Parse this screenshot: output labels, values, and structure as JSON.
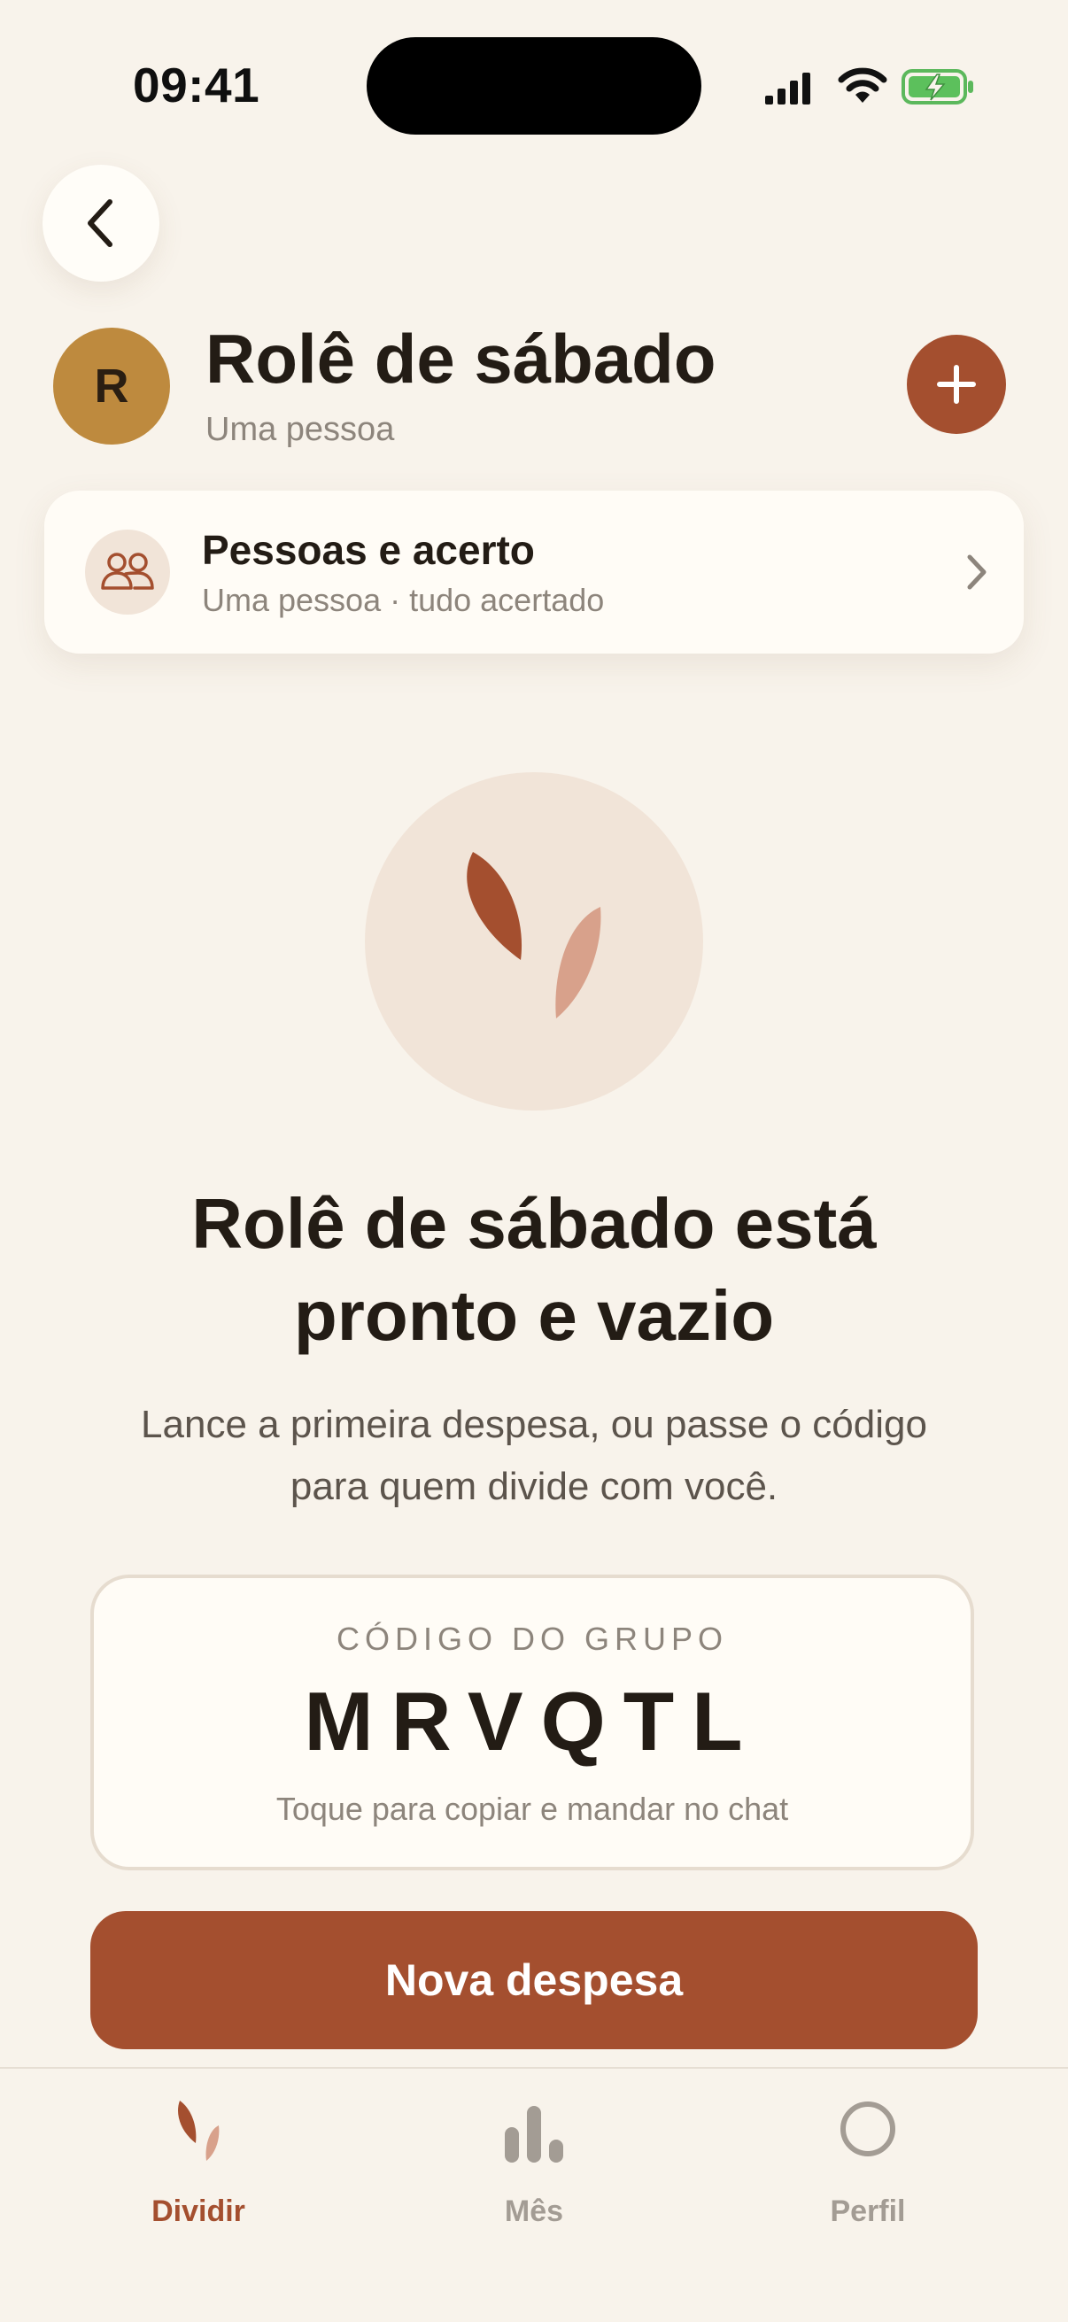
{
  "status_bar": {
    "time": "09:41",
    "icons": [
      "cellular-signal-icon",
      "wifi-icon",
      "battery-charging-icon"
    ]
  },
  "header": {
    "back_icon": "chevron-left-icon",
    "avatar_initial": "R",
    "title": "Rolê de sábado",
    "subtitle": "Uma pessoa",
    "add_icon": "plus-icon"
  },
  "people_card": {
    "icon": "people-icon",
    "title": "Pessoas e acerto",
    "subtitle": "Uma pessoa · tudo acertado",
    "chevron_icon": "chevron-right-icon"
  },
  "empty_state": {
    "illustration": "leaf-icon",
    "title_line1": "Rolê de sábado está",
    "title_line2": "pronto e vazio",
    "text_line1": "Lance a primeira despesa, ou passe o código",
    "text_line2": "para quem divide com você."
  },
  "code_card": {
    "label": "CÓDIGO DO GRUPO",
    "code": "MRVQTL",
    "hint": "Toque para copiar e mandar no chat"
  },
  "primary_button": {
    "label": "Nova despesa"
  },
  "tab_bar": {
    "tabs": [
      {
        "label": "Dividir",
        "icon": "leaf-icon",
        "active": true
      },
      {
        "label": "Mês",
        "icon": "bar-chart-icon",
        "active": false
      },
      {
        "label": "Perfil",
        "icon": "profile-circle-icon",
        "active": false
      }
    ]
  },
  "colors": {
    "background": "#F8F3EB",
    "card": "#FFFCF6",
    "accent": "#A44F2F",
    "accent_light": "#D8A18B",
    "avatar": "#BE8A3E",
    "muted_text": "#8D857C",
    "inactive_tab": "#A39C94"
  }
}
